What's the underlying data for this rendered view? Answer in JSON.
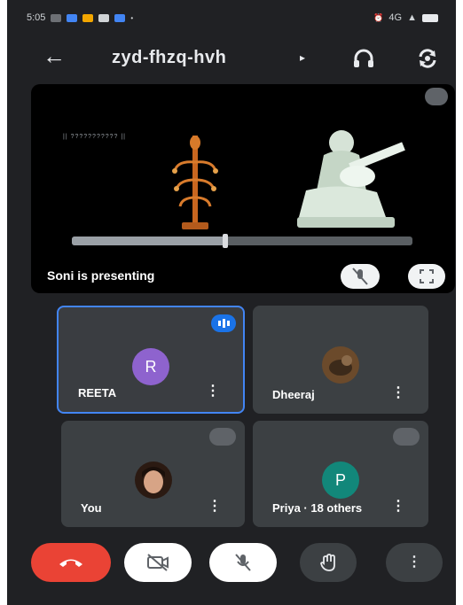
{
  "status_bar": {
    "time": "5:05",
    "signal": "4G",
    "colors": {
      "app1": "#4285f4",
      "app2": "#f2a600",
      "app3": "#ffffff"
    }
  },
  "header": {
    "meeting_code": "zyd-fhzq-hvh",
    "back_icon": "arrow-left-icon",
    "audio_icon": "headphones-icon",
    "switch_camera_icon": "flip-camera-icon"
  },
  "presentation": {
    "presenter_label": "Soni is presenting",
    "slide_caption": "|| ??????????? ||",
    "video_progress": 0.45
  },
  "participants": [
    {
      "name": "REETA",
      "initial": "R",
      "avatar_color": "#8e63ce",
      "speaking": true
    },
    {
      "name": "Dheeraj",
      "initial": "",
      "avatar_color": "#6b4a2b",
      "speaking": false
    },
    {
      "name": "You",
      "initial": "",
      "avatar_color": "#c28c74",
      "speaking": false
    },
    {
      "name": "Priya · 18 others",
      "initial": "P",
      "avatar_color": "#12877a",
      "speaking": false
    }
  ],
  "controls": {
    "end_call": "end-call-icon",
    "camera": "camera-off-icon",
    "microphone": "mic-off-icon",
    "raise_hand": "raise-hand-icon",
    "more": "more-options-icon"
  },
  "colors": {
    "background": "#202124",
    "tile": "#3c4043",
    "accent": "#1a73e8",
    "danger": "#ea4335"
  }
}
